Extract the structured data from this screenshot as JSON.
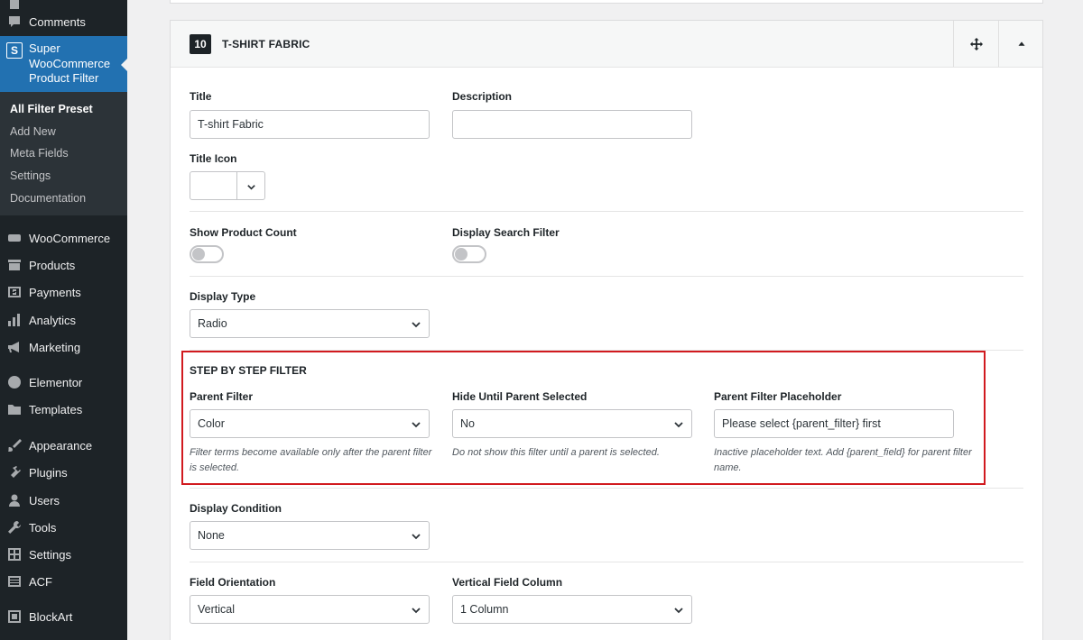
{
  "sidebar": {
    "top_items": [
      {
        "label": "Comments",
        "icon": "comment-icon"
      }
    ],
    "active": {
      "label": "Super WooCommerce Product Filter",
      "icon": "super-s-icon",
      "icon_letter": "S"
    },
    "submenu": [
      {
        "label": "All Filter Preset"
      },
      {
        "label": "Add New"
      },
      {
        "label": "Meta Fields"
      },
      {
        "label": "Settings"
      },
      {
        "label": "Documentation"
      }
    ],
    "items": [
      {
        "label": "WooCommerce",
        "icon": "woo-icon"
      },
      {
        "label": "Products",
        "icon": "archive-icon"
      },
      {
        "label": "Payments",
        "icon": "payments-icon"
      },
      {
        "label": "Analytics",
        "icon": "analytics-icon"
      },
      {
        "label": "Marketing",
        "icon": "megaphone-icon"
      },
      {
        "label": "Elementor",
        "icon": "elementor-icon"
      },
      {
        "label": "Templates",
        "icon": "folder-icon"
      },
      {
        "label": "Appearance",
        "icon": "paintbrush-icon"
      },
      {
        "label": "Plugins",
        "icon": "plugin-icon"
      },
      {
        "label": "Users",
        "icon": "users-icon"
      },
      {
        "label": "Tools",
        "icon": "wrench-icon"
      },
      {
        "label": "Settings",
        "icon": "settings-icon"
      },
      {
        "label": "ACF",
        "icon": "acf-icon"
      },
      {
        "label": "BlockArt",
        "icon": "blockart-icon"
      }
    ]
  },
  "panel": {
    "number": "10",
    "title": "T-SHIRT FABRIC",
    "move_icon": "move-icon",
    "collapse_icon": "caret-up-icon"
  },
  "form": {
    "title_label": "Title",
    "title_value": "T-shirt Fabric",
    "description_label": "Description",
    "description_value": "",
    "title_icon_label": "Title Icon",
    "show_count_label": "Show Product Count",
    "show_count_on": false,
    "search_filter_label": "Display Search Filter",
    "search_filter_on": false,
    "display_type_label": "Display Type",
    "display_type_value": "Radio",
    "step_heading": "STEP BY STEP FILTER",
    "parent_filter_label": "Parent Filter",
    "parent_filter_value": "Color",
    "parent_filter_help": "Filter terms become available only after the parent filter is selected.",
    "hide_until_label": "Hide Until Parent Selected",
    "hide_until_value": "No",
    "hide_until_help": "Do not show this filter until a parent is selected.",
    "placeholder_label": "Parent Filter Placeholder",
    "placeholder_value": "Please select {parent_filter} first",
    "placeholder_help": "Inactive placeholder text. Add {parent_field} for parent filter name.",
    "display_condition_label": "Display Condition",
    "display_condition_value": "None",
    "field_orientation_label": "Field Orientation",
    "field_orientation_value": "Vertical",
    "vertical_column_label": "Vertical Field Column",
    "vertical_column_value": "1 Column"
  },
  "colors": {
    "sidebar_bg": "#1d2327",
    "active_bg": "#2271b1",
    "highlight_border": "#d11a1f"
  }
}
